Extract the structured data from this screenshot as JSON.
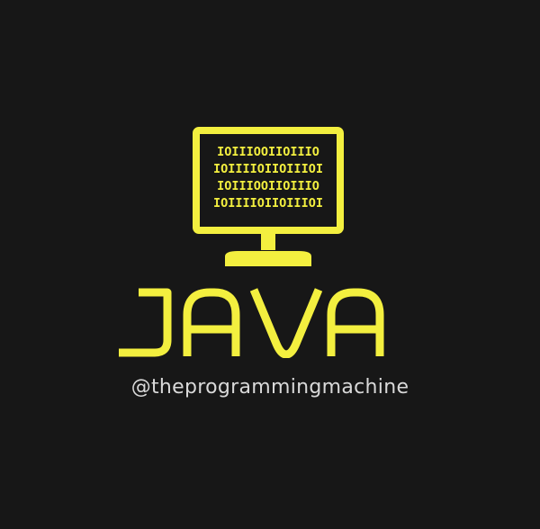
{
  "logo": {
    "binary_lines": [
      "IOIIIOOIIOIIIO",
      "IOIIIIOIIOIIIOI",
      "IOIIIOOIIOIIIO",
      "IOIIIIOIIOIIIOI"
    ],
    "title": "JAVA",
    "handle": "@theprogrammingmachine",
    "accent_color": "#f3ef3f",
    "background_color": "#171717",
    "handle_color": "#d9d9d9",
    "icon": "computer-monitor-icon"
  }
}
